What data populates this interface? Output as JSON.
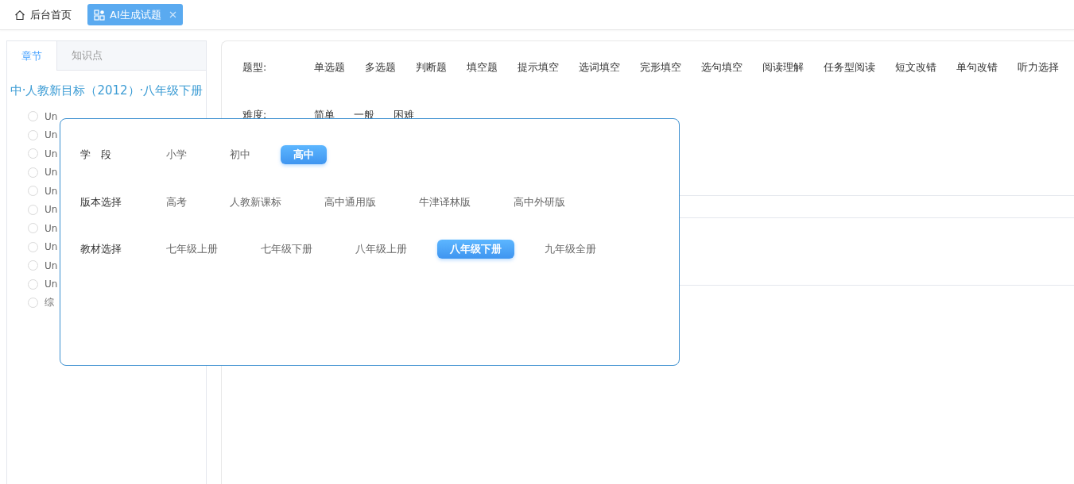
{
  "top_tabs": [
    {
      "label": "后台首页",
      "selected": false,
      "closable": false
    },
    {
      "label": "AI生成试题",
      "selected": true,
      "closable": true
    }
  ],
  "sidebar": {
    "tabs": [
      {
        "label": "章节",
        "selected": true
      },
      {
        "label": "知识点",
        "selected": false
      }
    ],
    "book_title": "中·人教新目标（2012）·八年级下册",
    "items": [
      {
        "label": "Un",
        "checked": false
      },
      {
        "label": "Un",
        "checked": false
      },
      {
        "label": "Un",
        "checked": false
      },
      {
        "label": "Un",
        "checked": false
      },
      {
        "label": "Un",
        "checked": false
      },
      {
        "label": "Un",
        "checked": false
      },
      {
        "label": "Un",
        "checked": false
      },
      {
        "label": "Un",
        "checked": false
      },
      {
        "label": "Un",
        "checked": false
      },
      {
        "label": "Un",
        "checked": false
      },
      {
        "label": "综",
        "checked": false
      }
    ]
  },
  "filters": [
    {
      "label": "题型:",
      "options": [
        {
          "label": "单选题",
          "selected": false
        },
        {
          "label": "多选题",
          "selected": false
        },
        {
          "label": "判断题",
          "selected": false
        },
        {
          "label": "填空题",
          "selected": false
        },
        {
          "label": "提示填空",
          "selected": false
        },
        {
          "label": "选词填空",
          "selected": false
        },
        {
          "label": "完形填空",
          "selected": false
        },
        {
          "label": "选句填空",
          "selected": false
        },
        {
          "label": "阅读理解",
          "selected": false
        },
        {
          "label": "任务型阅读",
          "selected": false
        },
        {
          "label": "短文改错",
          "selected": false
        },
        {
          "label": "单句改错",
          "selected": false
        },
        {
          "label": "听力选择",
          "selected": false
        }
      ]
    },
    {
      "label": "难度:",
      "options": [
        {
          "label": "简单",
          "selected": false
        },
        {
          "label": "一般",
          "selected": false
        },
        {
          "label": "困难",
          "selected": false
        }
      ]
    }
  ],
  "popup": {
    "rows": [
      {
        "label": "学　段",
        "options": [
          {
            "label": "小学",
            "selected": false
          },
          {
            "label": "初中",
            "selected": false
          },
          {
            "label": "高中",
            "selected": true
          }
        ]
      },
      {
        "label": "版本选择",
        "options": [
          {
            "label": "高考",
            "selected": false
          },
          {
            "label": "人教新课标",
            "selected": false
          },
          {
            "label": "高中通用版",
            "selected": false
          },
          {
            "label": "牛津译林版",
            "selected": false
          },
          {
            "label": "高中外研版",
            "selected": false
          }
        ]
      },
      {
        "label": "教材选择",
        "options": [
          {
            "label": "七年级上册",
            "selected": false
          },
          {
            "label": "七年级下册",
            "selected": false
          },
          {
            "label": "八年级上册",
            "selected": false
          },
          {
            "label": "八年级下册",
            "selected": true
          },
          {
            "label": "九年级全册",
            "selected": false
          }
        ]
      }
    ]
  }
}
